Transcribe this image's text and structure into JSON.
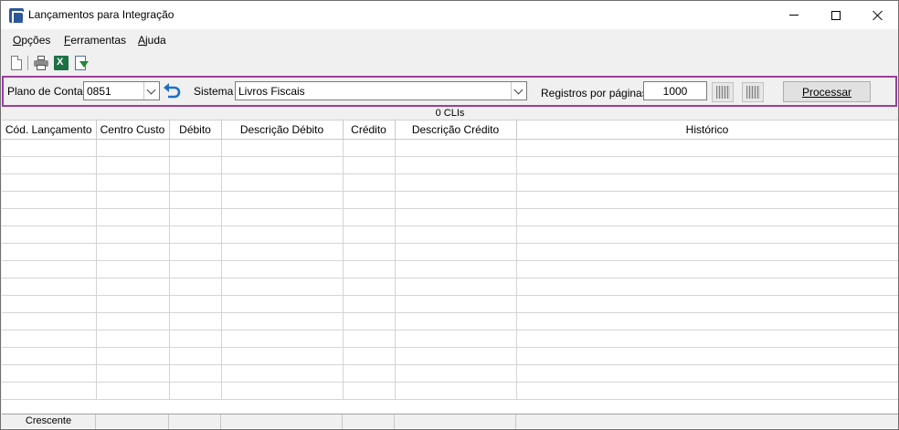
{
  "window": {
    "title": "Lançamentos para Integração"
  },
  "menu": [
    {
      "label": "Opções",
      "accel": "O",
      "rest": "pções"
    },
    {
      "label": "Ferramentas",
      "accel": "F",
      "rest": "erramentas"
    },
    {
      "label": "Ajuda",
      "accel": "A",
      "rest": "juda"
    }
  ],
  "toolbar": {
    "icons": [
      "new-document-icon",
      "print-icon",
      "excel-export-icon",
      "export-download-icon"
    ]
  },
  "filter": {
    "plano_label": "Plano de Contas",
    "plano_value": "0851",
    "sistema_label": "Sistema",
    "sistema_value": "Livros Fiscais",
    "registros_label": "Registros por páginas:",
    "registros_value": "1000",
    "processar_label": "Processar",
    "accent_color": "#9b3d9e"
  },
  "grid": {
    "count_label": "0 CLIs",
    "columns": [
      "Cód. Lançamento",
      "Centro Custo",
      "Débito",
      "Descrição Débito",
      "Crédito",
      "Descrição Crédito",
      "Histórico"
    ],
    "rows": [],
    "footer": {
      "sort_label": "Crescente"
    }
  }
}
